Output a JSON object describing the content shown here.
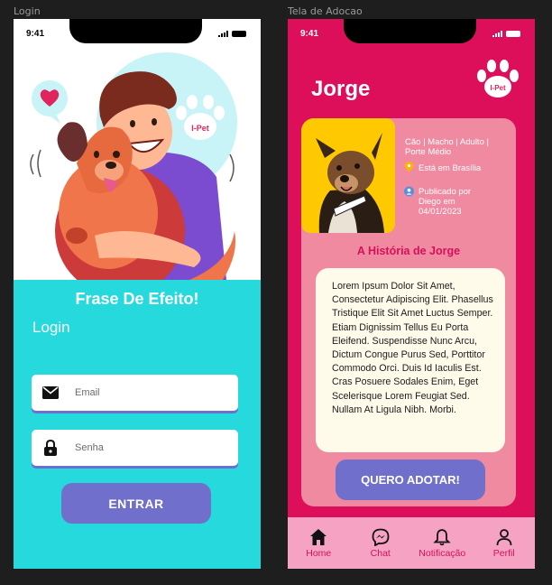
{
  "frames": {
    "login_label": "Login",
    "adoption_label": "Tela de Adocao"
  },
  "status_bar": {
    "time": "9:41"
  },
  "login": {
    "logo_text": "I-Pet",
    "slogan": "Frase De Efeito!",
    "title": "Login",
    "email_placeholder": "Email",
    "password_placeholder": "Senha",
    "submit_label": "ENTRAR"
  },
  "adoption": {
    "pet_name": "Jorge",
    "logo_text": "I-Pet",
    "details": "Cão | Macho | Adulto | Porte Médio",
    "location": "Está em Brasília",
    "published_line1": "Publicado por",
    "published_line2": "Diego em",
    "published_date": "04/01/2023",
    "story_title": "A História de Jorge",
    "story_text": "Lorem Ipsum Dolor Sit Amet, Consectetur Adipiscing Elit. Phasellus Tristique Elit Sit Amet Luctus Semper. Etiam Dignissim Tellus Eu Porta Eleifend. Suspendisse Nunc Arcu, Dictum Congue Purus Sed, Porttitor Commodo Orci. Duis Id Iaculis Est. Cras Posuere Sodales Enim, Eget Scelerisque Lorem Feugiat Sed. Nullam At Ligula Nibh. Morbi.",
    "adopt_button": "QUERO ADOTAR!"
  },
  "nav": {
    "items": [
      {
        "label": "Home",
        "icon": "home-icon"
      },
      {
        "label": "Chat",
        "icon": "messenger-icon"
      },
      {
        "label": "Notificação",
        "icon": "bell-icon"
      },
      {
        "label": "Perfil",
        "icon": "user-icon"
      }
    ]
  },
  "colors": {
    "login_accent": "#25d9dd",
    "button": "#7070cc",
    "adoption_bg": "#dd0f5a",
    "card": "#f08aa0",
    "photo_bg": "#ffc900",
    "story_bg": "#fffbea",
    "nav_bg": "#f6a3c3"
  }
}
